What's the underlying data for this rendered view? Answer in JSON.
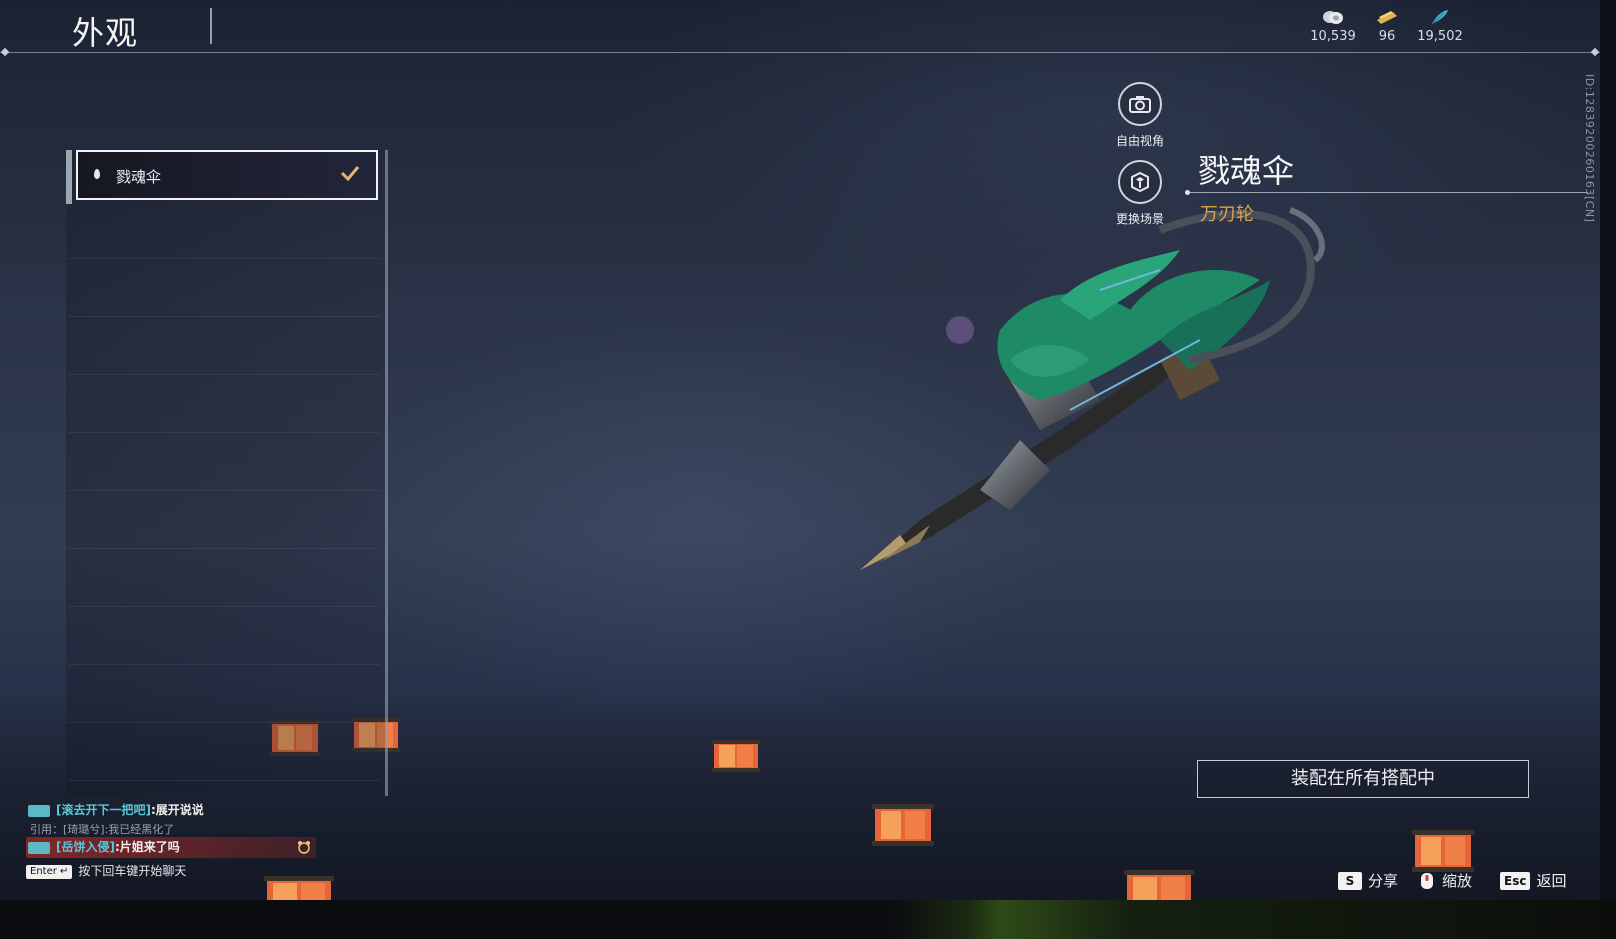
{
  "header": {
    "title": "外观",
    "currencies": [
      {
        "icon": "coin-stack-icon",
        "value": "10,539"
      },
      {
        "icon": "gold-ticket-icon",
        "value": "96"
      },
      {
        "icon": "feather-icon",
        "value": "19,502"
      }
    ]
  },
  "list": {
    "items": [
      {
        "label": "戮魂伞",
        "selected": true
      }
    ]
  },
  "side_buttons": {
    "free_camera": "自由视角",
    "change_scene": "更换场景"
  },
  "item": {
    "name": "戮魂伞",
    "type": "万刃轮",
    "id_text": "ID:1283920026016​3[CN]"
  },
  "equip_button": "装配在所有搭配中",
  "chat": {
    "lines": [
      {
        "channel": "[滚去开下一把吧]",
        "message": ":展开说说"
      },
      {
        "quote": "引用：[琦璐兮]:我已经黑化了"
      },
      {
        "channel": "[岳饼入侵]",
        "message": ":片姐来了吗"
      }
    ],
    "enter_key": "Enter ↵",
    "hint": "按下回车键开始聊天"
  },
  "shortcuts": [
    {
      "key": "S",
      "label": "分享"
    },
    {
      "key": "",
      "label": "缩放"
    },
    {
      "key": "Esc",
      "label": "返回"
    }
  ],
  "colors": {
    "accent_gold": "#d9a34a",
    "chat_channel": "#58c7d8",
    "weapon_green": "#1f8a66"
  }
}
